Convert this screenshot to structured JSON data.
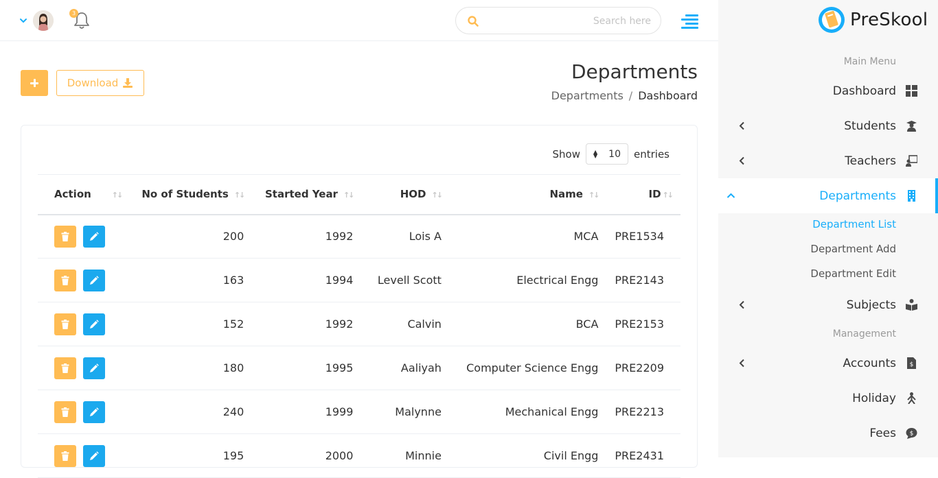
{
  "header": {
    "notifications_count": "3",
    "search_placeholder": "Search here"
  },
  "page": {
    "title": "Departments",
    "breadcrumb": {
      "link": "Departments",
      "separator": "/",
      "current": "Dashboard"
    },
    "download_label": "Download"
  },
  "entries": {
    "show": "Show",
    "value": "10",
    "suffix": "entries"
  },
  "table": {
    "headers": [
      "Action",
      "No of Students",
      "Started Year",
      "HOD",
      "Name",
      "ID"
    ],
    "rows": [
      {
        "students": "200",
        "year": "1992",
        "hod": "Lois A",
        "name": "MCA",
        "id": "PRE1534"
      },
      {
        "students": "163",
        "year": "1994",
        "hod": "Levell Scott",
        "name": "Electrical Engg",
        "id": "PRE2143"
      },
      {
        "students": "152",
        "year": "1992",
        "hod": "Calvin",
        "name": "BCA",
        "id": "PRE2153"
      },
      {
        "students": "180",
        "year": "1995",
        "hod": "Aaliyah",
        "name": "Computer Science Engg",
        "id": "PRE2209"
      },
      {
        "students": "240",
        "year": "1999",
        "hod": "Malynne",
        "name": "Mechanical Engg",
        "id": "PRE2213"
      },
      {
        "students": "195",
        "year": "2000",
        "hod": "Minnie",
        "name": "Civil Engg",
        "id": "PRE2431"
      }
    ]
  },
  "sidebar": {
    "logo_text": "PreSkool",
    "main_menu_title": "Main Menu",
    "management_title": "Management",
    "items": [
      {
        "label": "Dashboard",
        "icon": "dashboard-grid-icon"
      },
      {
        "label": "Students",
        "icon": "graduate-icon"
      },
      {
        "label": "Teachers",
        "icon": "teacher-board-icon"
      },
      {
        "label": "Departments",
        "icon": "building-icon"
      },
      {
        "label": "Subjects",
        "icon": "book-reader-icon"
      },
      {
        "label": "Accounts",
        "icon": "invoice-file-icon"
      },
      {
        "label": "Holiday",
        "icon": "holiday-person-icon"
      },
      {
        "label": "Fees",
        "icon": "comment-dollar-icon"
      }
    ],
    "department_sub": [
      "Department List",
      "Department Add",
      "Department Edit"
    ]
  },
  "colors": {
    "accent_blue": "#18aefa",
    "accent_yellow": "#ffbc53",
    "edit_blue": "#1ba9ee"
  }
}
